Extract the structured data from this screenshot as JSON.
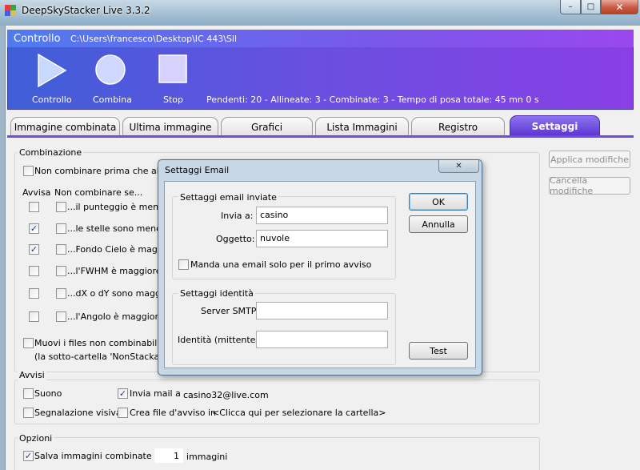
{
  "window": {
    "title": "DeepSkyStacker Live 3.3.2",
    "minimize": "–",
    "maximize": "□",
    "close": "✕"
  },
  "control": {
    "title": "Controllo",
    "path": "C:\\Users\\francesco\\Desktop\\IC 443\\Sll",
    "buttons": [
      {
        "label": "Controllo",
        "icon": "play-icon"
      },
      {
        "label": "Combina",
        "icon": "circle-icon"
      },
      {
        "label": "Stop",
        "icon": "stop-icon"
      }
    ],
    "status": "Pendenti: 20 - Allineate: 3 - Combinate: 3 - Tempo di posa totale: 45 mn 0 s"
  },
  "tabs": [
    "Immagine combinata",
    "Ultima immagine",
    "Grafici",
    "Lista Immagini",
    "Registro",
    "Settaggi"
  ],
  "active_tab": "Settaggi",
  "combinazione": {
    "title": "Combinazione",
    "no_combine": "Non combinare prima che almeno",
    "avvisa_hdr": "Avvisa",
    "noncombinare_hdr": "Non combinare se...",
    "rows": [
      {
        "label": "...il punteggio è meno d",
        "avvisa": false
      },
      {
        "label": "...le stelle sono meno di",
        "avvisa": true
      },
      {
        "label": "...Fondo Cielo è maggio",
        "avvisa": true
      },
      {
        "label": "...l'FWHM è maggiore di",
        "avvisa": false
      },
      {
        "label": "...dX o dY sono maggior",
        "avvisa": false
      },
      {
        "label": "...l'Angolo è maggiore d",
        "avvisa": false
      }
    ],
    "move_files": "Muovi i files non combinabili nella",
    "move_files_sub": "(la sotto-cartella 'NonStackable'"
  },
  "side_buttons": {
    "apply": "Applica modifiche",
    "cancel": "Cancella modifiche"
  },
  "avvisi": {
    "title": "Avvisi",
    "suono": "Suono",
    "invia_mail": "Invia mail a",
    "email": "casino32@live.com",
    "segnalazione": "Segnalazione visiva",
    "crea_file": "Crea file d'avviso in",
    "cartella": "<Clicca qui per selezionare la cartella>"
  },
  "opzioni": {
    "title": "Opzioni",
    "salva": "Salva immagini combinate ogni",
    "count": "1",
    "unit": "immagini"
  },
  "dialog": {
    "title": "Settaggi Email",
    "sent_group": "Settaggi email inviate",
    "to_label": "Invia a:",
    "to_value": "casino",
    "subject_label": "Oggetto:",
    "subject_value": "nuvole",
    "first_only": "Manda una email solo per il primo avviso",
    "identity_group": "Settaggi identità",
    "smtp_label": "Server SMTP:",
    "smtp_value": "",
    "sender_label": "Identità (mittente):",
    "sender_value": "",
    "ok": "OK",
    "cancel": "Annulla",
    "test": "Test",
    "close": "✕"
  }
}
